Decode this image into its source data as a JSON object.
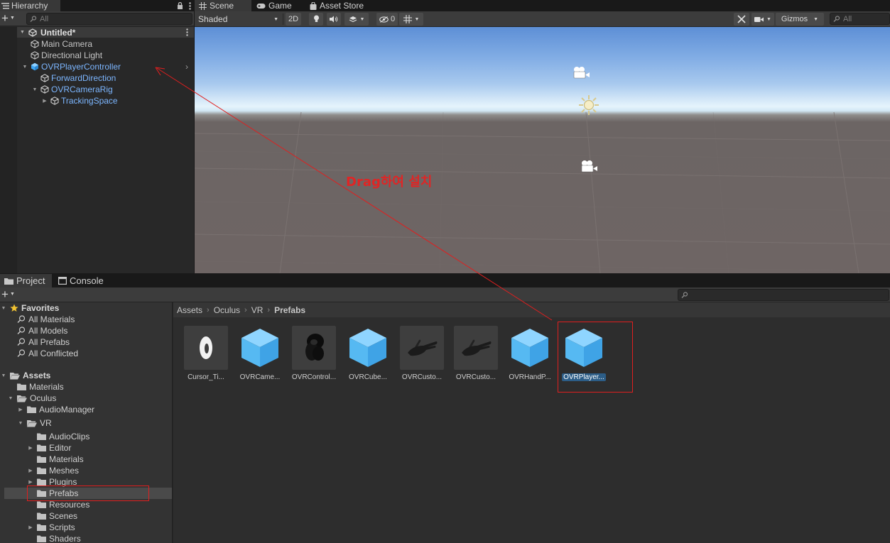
{
  "colors": {
    "accent_blue": "#7cb6ff",
    "annotation_red": "#e01f1f",
    "selection": "#2c5d87"
  },
  "hierarchy": {
    "tab_label": "Hierarchy",
    "search_placeholder": "All",
    "scene_name": "Untitled*",
    "items": [
      {
        "label": "Main Camera",
        "depth": 1,
        "prefab": false,
        "expand": ""
      },
      {
        "label": "Directional Light",
        "depth": 1,
        "prefab": false,
        "expand": ""
      },
      {
        "label": "OVRPlayerController",
        "depth": 1,
        "prefab": true,
        "expand": "▼"
      },
      {
        "label": "ForwardDirection",
        "depth": 2,
        "prefab": true,
        "expand": ""
      },
      {
        "label": "OVRCameraRig",
        "depth": 2,
        "prefab": true,
        "expand": "▼"
      },
      {
        "label": "TrackingSpace",
        "depth": 3,
        "prefab": true,
        "expand": "▶"
      }
    ]
  },
  "scene": {
    "tabs": [
      {
        "label": "Scene",
        "icon": "grid-icon"
      },
      {
        "label": "Game",
        "icon": "gamepad-icon"
      },
      {
        "label": "Asset Store",
        "icon": "bag-icon"
      }
    ],
    "shading_mode": "Shaded",
    "mode_2d": "2D",
    "hidden_count": "0",
    "gizmos_label": "Gizmos",
    "search_placeholder": "All",
    "annotation": "Drag하여 설치"
  },
  "project": {
    "tabs": [
      {
        "label": "Project",
        "icon": "folder-icon"
      },
      {
        "label": "Console",
        "icon": "console-icon"
      }
    ],
    "favorites_label": "Favorites",
    "favorites": [
      "All Materials",
      "All Models",
      "All Prefabs",
      "All Conflicted"
    ],
    "assets_label": "Assets",
    "folders": [
      {
        "label": "Materials",
        "depth": 1,
        "expand": ""
      },
      {
        "label": "Oculus",
        "depth": 1,
        "expand": "▼",
        "open": true
      },
      {
        "label": "AudioManager",
        "depth": 2,
        "expand": "▶"
      },
      {
        "label": "VR",
        "depth": 2,
        "expand": "▼",
        "open": true
      },
      {
        "label": "AudioClips",
        "depth": 3,
        "expand": ""
      },
      {
        "label": "Editor",
        "depth": 3,
        "expand": "▶"
      },
      {
        "label": "Materials",
        "depth": 3,
        "expand": ""
      },
      {
        "label": "Meshes",
        "depth": 3,
        "expand": "▶"
      },
      {
        "label": "Plugins",
        "depth": 3,
        "expand": "▶"
      },
      {
        "label": "Prefabs",
        "depth": 3,
        "expand": "",
        "selected": true
      },
      {
        "label": "Resources",
        "depth": 3,
        "expand": ""
      },
      {
        "label": "Scenes",
        "depth": 3,
        "expand": ""
      },
      {
        "label": "Scripts",
        "depth": 3,
        "expand": "▶"
      },
      {
        "label": "Shaders",
        "depth": 3,
        "expand": ""
      }
    ],
    "breadcrumb": [
      "Assets",
      "Oculus",
      "VR",
      "Prefabs"
    ],
    "assets": [
      {
        "label": "Cursor_Ti...",
        "thumb": "ring-icon"
      },
      {
        "label": "OVRCame...",
        "thumb": "cube-icon"
      },
      {
        "label": "OVRControl...",
        "thumb": "controller-icon"
      },
      {
        "label": "OVRCube...",
        "thumb": "cube-icon"
      },
      {
        "label": "OVRCusto...",
        "thumb": "hand-icon"
      },
      {
        "label": "OVRCusto...",
        "thumb": "hand-icon"
      },
      {
        "label": "OVRHandP...",
        "thumb": "cube-icon"
      },
      {
        "label": "OVRPlayer...",
        "thumb": "cube-icon",
        "selected": true
      }
    ]
  }
}
